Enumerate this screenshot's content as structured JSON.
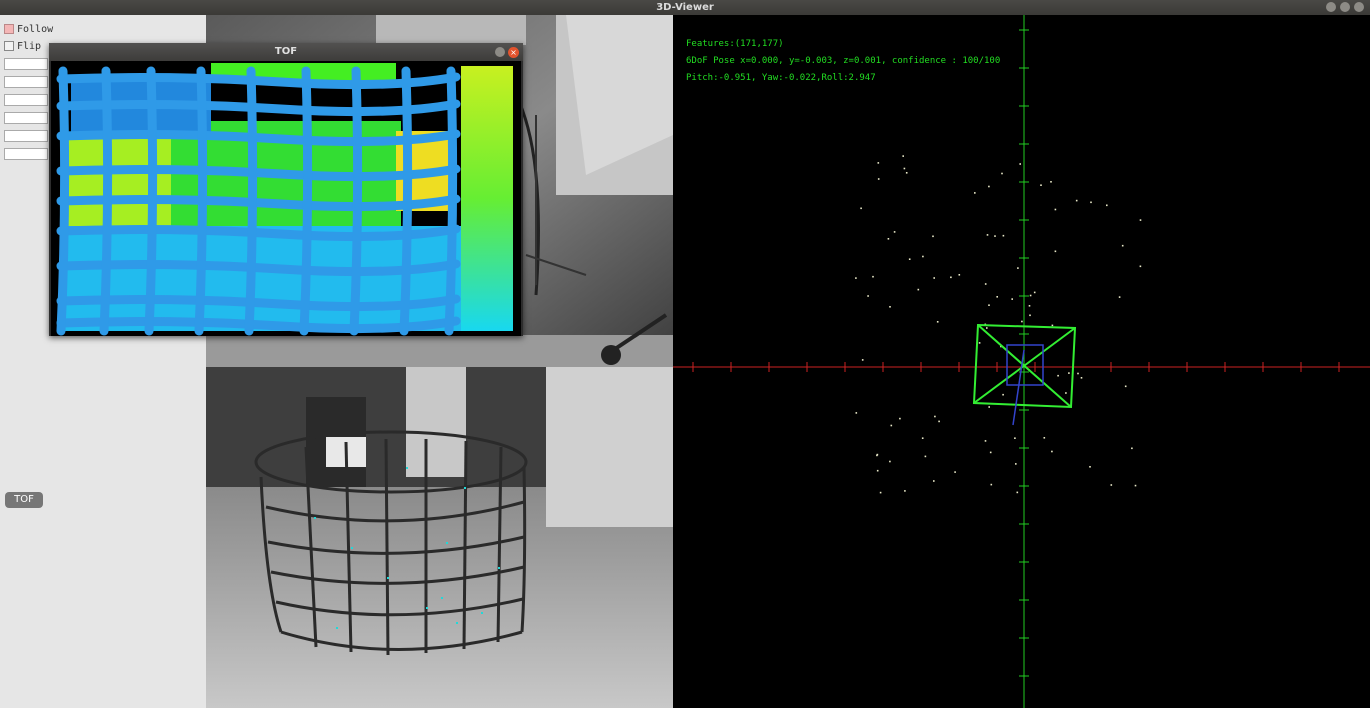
{
  "window": {
    "title": "3D-Viewer"
  },
  "panel": {
    "follow_label": "Follow",
    "flip_label": "Flip",
    "tof_button": "TOF"
  },
  "tof_window": {
    "title": "TOF"
  },
  "viewer": {
    "features": "Features:(171,177)",
    "pose": "6DoF Pose x=0.000, y=-0.003, z=0.001, confidence : 100/100",
    "orientation": "Pitch:-0.951, Yaw:-0.022,Roll:2.947"
  },
  "colors": {
    "x_axis": "#cc2222",
    "y_axis": "#22cc22",
    "camera_frame": "#33ee33",
    "overlay_text": "#22dd22"
  },
  "icons": [
    "minimize-icon",
    "maximize-icon",
    "close-icon"
  ]
}
